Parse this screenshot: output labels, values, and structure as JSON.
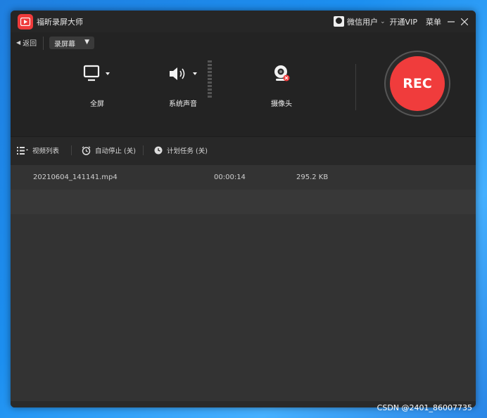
{
  "app": {
    "title": "福昕录屏大师"
  },
  "titlebar": {
    "user": "微信用户",
    "vip": "开通VIP",
    "menu": "菜单"
  },
  "toolbar": {
    "back": "返回",
    "mode": "录屏幕",
    "sources": [
      {
        "label": "全屏",
        "icon": "monitor-icon"
      },
      {
        "label": "系统声音",
        "icon": "speaker-icon"
      },
      {
        "label": "摄像头",
        "icon": "webcam-icon"
      }
    ],
    "rec": "REC"
  },
  "tabs": {
    "video_list": "视频列表",
    "auto_stop": "自动停止 (关)",
    "schedule": "计划任务 (关)"
  },
  "files": [
    {
      "name": "20210604_141141.mp4",
      "duration": "00:00:14",
      "size": "295.2 KB"
    }
  ],
  "watermark": "CSDN @2401_86007735",
  "colors": {
    "accent": "#f03c3c",
    "bg": "#2f2f2f",
    "desktop": "#1c8ff0"
  }
}
